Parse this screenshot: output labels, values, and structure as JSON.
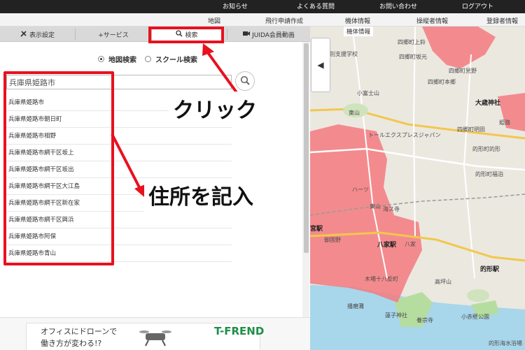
{
  "topbar": {
    "links": [
      "お知らせ",
      "よくある質問",
      "お問い合わせ",
      "ログアウト"
    ]
  },
  "subnav": {
    "links": [
      "地図",
      "飛行申請作成",
      "機体情報",
      "操縦者情報",
      "登録者情報"
    ]
  },
  "tabs": {
    "settings": "表示設定",
    "service": "+サービス",
    "search": "検索",
    "video": "JUIDA会員動画"
  },
  "search_mode": {
    "options": [
      {
        "label": "地図検索",
        "selected": true
      },
      {
        "label": "スクール検索",
        "selected": false
      }
    ]
  },
  "search": {
    "value": "兵庫県姫路市"
  },
  "suggestions": [
    "兵庫県姫路市",
    "兵庫県姫路市朝日町",
    "兵庫県姫路市相野",
    "兵庫県姫路市網干区坂上",
    "兵庫県姫路市網干区坂出",
    "兵庫県姫路市網干区大江島",
    "兵庫県姫路市網干区新在家",
    "兵庫県姫路市網干区興浜",
    "兵庫県姫路市阿保",
    "兵庫県姫路市青山"
  ],
  "annotations": {
    "click": "クリック",
    "enter_address": "住所を記入"
  },
  "ad": {
    "line1": "オフィスにドローンで",
    "line2": "働き方が変わる!?",
    "logo": "T-FREND"
  },
  "map": {
    "labels": [
      "四郷町上鈴",
      "四郷町坂元",
      "四郷町本郷",
      "四郷町見野",
      "大歳神社",
      "四郷町明田",
      "東山",
      "小富士山",
      "姫路特別支援学校",
      "兵庫県姫路市",
      "トールエクスプレスジャパン",
      "的形町的形",
      "的形町福泊",
      "的形町",
      "宮駅",
      "八家駅",
      "的形駅",
      "八家",
      "木場十八反町",
      "高坪山",
      "蓮子神社",
      "播磨灘",
      "小赤壁公園",
      "養宗寺",
      "的形海水浴場",
      "海ス寺",
      "姫路",
      "ハーツ",
      "御国野",
      "東山"
    ]
  },
  "colors": {
    "accent_red": "#e8111f",
    "zone_red": "#f47a7f",
    "map_bg": "#e9e6df",
    "sea": "#a8d6ea",
    "park_green": "#b6dda0"
  }
}
